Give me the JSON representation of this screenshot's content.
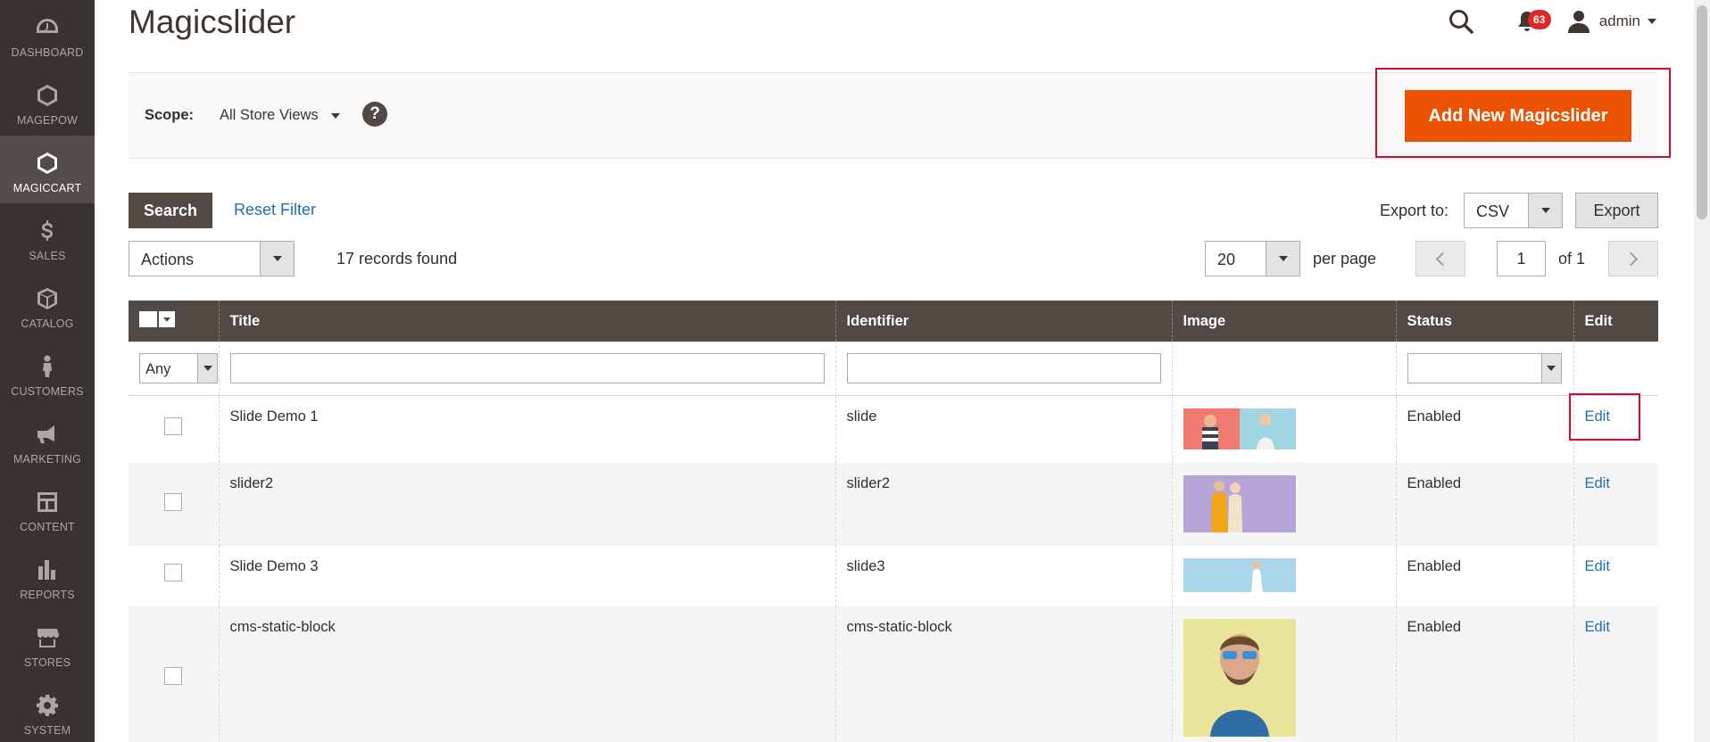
{
  "sidebar": {
    "items": [
      {
        "label": "DASHBOARD",
        "icon": "dashboard-icon"
      },
      {
        "label": "MAGEPOW",
        "icon": "hexagon-icon"
      },
      {
        "label": "MAGICCART",
        "icon": "hexagon-icon",
        "active": true
      },
      {
        "label": "SALES",
        "icon": "dollar-icon"
      },
      {
        "label": "CATALOG",
        "icon": "box-icon"
      },
      {
        "label": "CUSTOMERS",
        "icon": "person-icon"
      },
      {
        "label": "MARKETING",
        "icon": "megaphone-icon"
      },
      {
        "label": "CONTENT",
        "icon": "layout-icon"
      },
      {
        "label": "REPORTS",
        "icon": "bar-chart-icon"
      },
      {
        "label": "STORES",
        "icon": "storefront-icon"
      },
      {
        "label": "SYSTEM",
        "icon": "gear-icon"
      }
    ]
  },
  "header": {
    "title": "Magicslider",
    "notifications_count": "63",
    "admin_name": "admin"
  },
  "scope": {
    "label": "Scope:",
    "value": "All Store Views",
    "help": "?"
  },
  "add_button_label": "Add New Magicslider",
  "toolbar": {
    "search_label": "Search",
    "reset_label": "Reset Filter",
    "export_label": "Export to:",
    "export_format": "CSV",
    "export_button": "Export",
    "actions_label": "Actions",
    "records_found": "17 records found",
    "per_page_value": "20",
    "per_page_label": "per page",
    "current_page": "1",
    "total_pages_label": "of 1"
  },
  "table": {
    "columns": [
      "Title",
      "Identifier",
      "Image",
      "Status",
      "Edit"
    ],
    "filter_any": "Any",
    "rows": [
      {
        "title": "Slide Demo 1",
        "identifier": "slide",
        "status": "Enabled",
        "edit": "Edit"
      },
      {
        "title": "slider2",
        "identifier": "slider2",
        "status": "Enabled",
        "edit": "Edit"
      },
      {
        "title": "Slide Demo 3",
        "identifier": "slide3",
        "status": "Enabled",
        "edit": "Edit"
      },
      {
        "title": "cms-static-block",
        "identifier": "cms-static-block",
        "status": "Enabled",
        "edit": "Edit"
      }
    ]
  },
  "colors": {
    "sidebar_bg": "#373330",
    "accent": "#eb5202",
    "header_dark": "#514943",
    "link": "#1f6fa9",
    "highlight": "#c8102e"
  }
}
